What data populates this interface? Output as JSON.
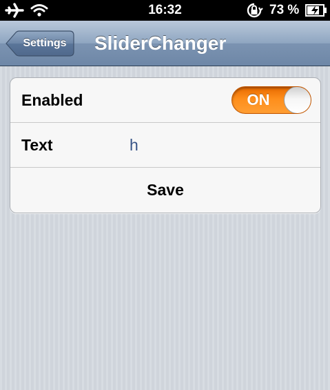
{
  "status_bar": {
    "time": "16:32",
    "battery_percent": "73 %",
    "icons": [
      "airplane-icon",
      "wifi-icon",
      "rotation-lock-icon",
      "battery-charging-icon"
    ]
  },
  "nav_bar": {
    "back_label": "Settings",
    "title": "SliderChanger"
  },
  "table": {
    "enabled_label": "Enabled",
    "enabled_switch_text": "ON",
    "enabled_state": true,
    "text_label": "Text",
    "text_value": "h",
    "save_label": "Save"
  },
  "colors": {
    "switch_on": "#FF8A1A",
    "value_text": "#385487",
    "nav_bar": "#7B93B1"
  }
}
